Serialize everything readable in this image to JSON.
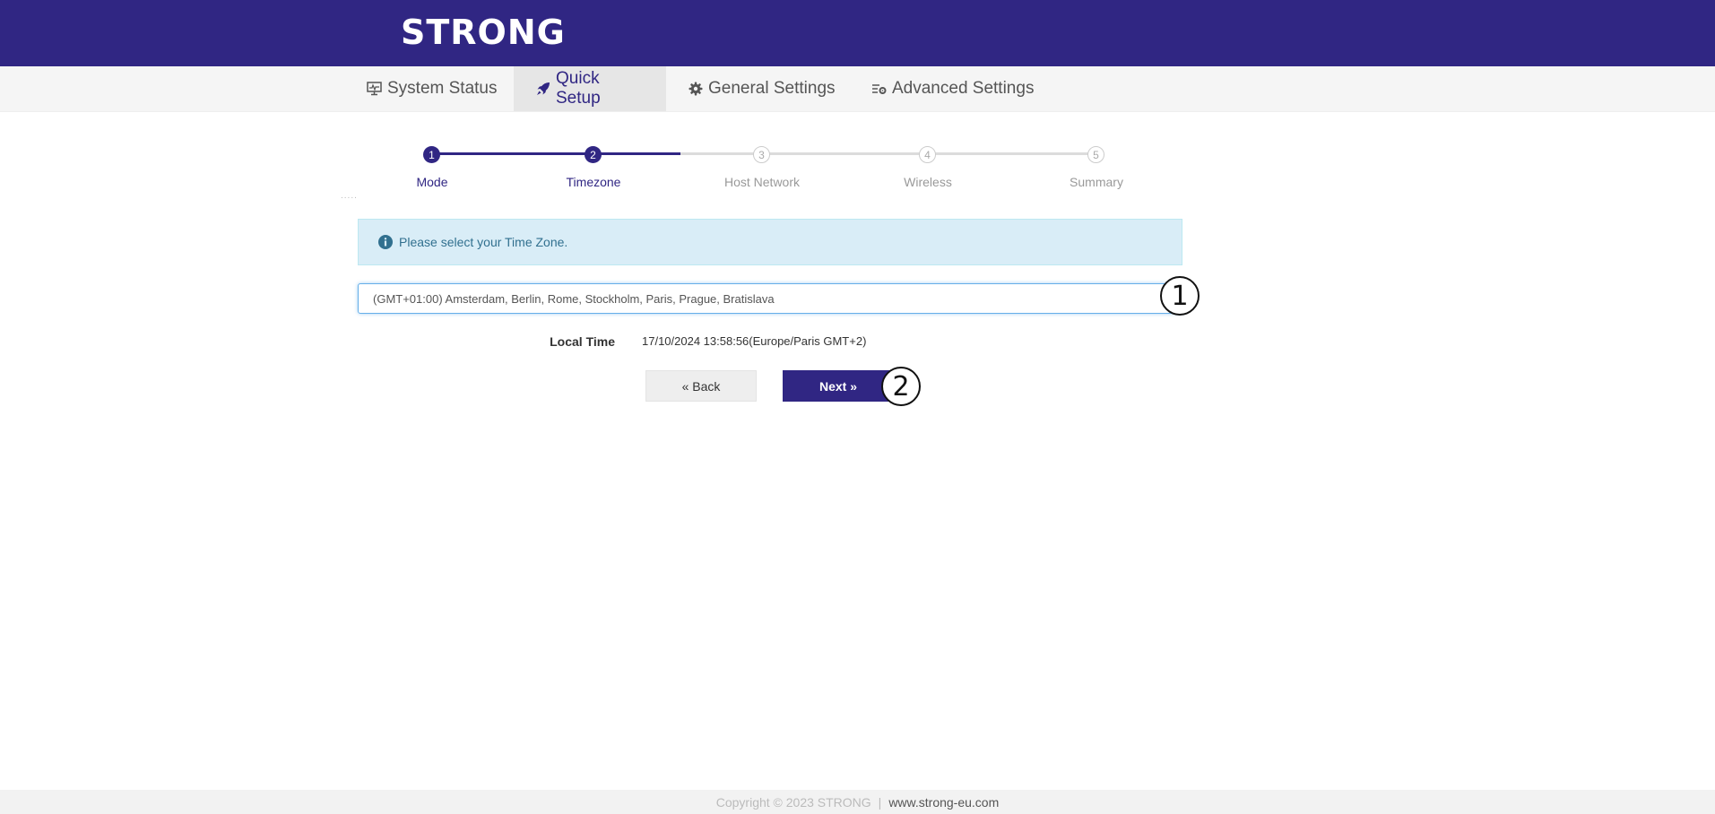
{
  "header": {
    "logo_text": "STRONG",
    "brand_color": "#302683"
  },
  "nav": {
    "tabs": [
      {
        "label": "System Status",
        "icon": "monitor-icon",
        "active": false
      },
      {
        "label": "Quick Setup",
        "icon": "rocket-icon",
        "active": true
      },
      {
        "label": "General Settings",
        "icon": "gear-icon",
        "active": false
      },
      {
        "label": "Advanced Settings",
        "icon": "advanced-settings-icon",
        "active": false
      }
    ]
  },
  "wizard": {
    "steps": [
      {
        "number": "1",
        "label": "Mode",
        "done": true
      },
      {
        "number": "2",
        "label": "Timezone",
        "done": true
      },
      {
        "number": "3",
        "label": "Host Network",
        "done": false
      },
      {
        "number": "4",
        "label": "Wireless",
        "done": false
      },
      {
        "number": "5",
        "label": "Summary",
        "done": false
      }
    ],
    "separator_text": "....."
  },
  "alert": {
    "icon": "info-icon",
    "text": "Please select your Time Zone."
  },
  "timezone": {
    "selected": "(GMT+01:00) Amsterdam, Berlin, Rome, Stockholm, Paris, Prague, Bratislava"
  },
  "local_time": {
    "label": "Local Time",
    "value": "17/10/2024 13:58:56(Europe/Paris GMT+2)"
  },
  "buttons": {
    "back": "« Back",
    "next": "Next »"
  },
  "markers": [
    "1",
    "2"
  ],
  "footer": {
    "copyright": "Copyright © 2023 STRONG",
    "separator": "|",
    "website": "www.strong-eu.com"
  }
}
